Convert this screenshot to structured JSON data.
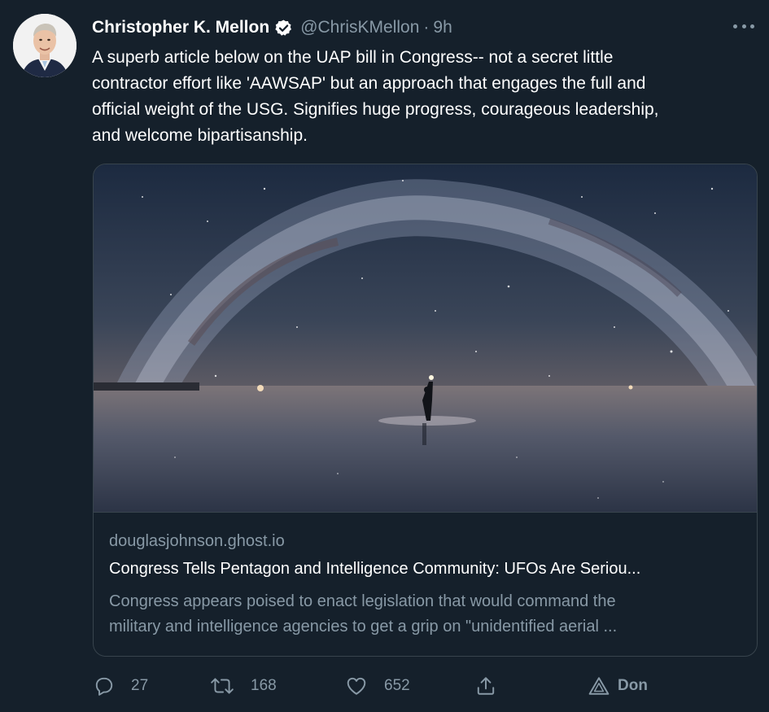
{
  "author": {
    "display_name": "Christopher K. Mellon",
    "handle": "@ChrisKMellon",
    "separator": "·",
    "time": "9h",
    "verified": true,
    "avatar_icon": "avatar-photo"
  },
  "tweet": {
    "text": "A superb article below on the UAP bill in Congress-- not a secret little\ncontractor effort like 'AAWSAP' but an approach that engages the full and\nofficial weight of the USG. Signifies huge progress, courageous leadership,\nand welcome bipartisanship."
  },
  "card": {
    "domain": "douglasjohnson.ghost.io",
    "title": "Congress Tells Pentagon and Intelligence Community: UFOs Are Seriou...",
    "description": "Congress appears poised to enact legislation that would command the\nmilitary and intelligence agencies to get a grip on \"unidentified aerial ...",
    "image_icon": "milky-way-photo"
  },
  "actions": {
    "reply_count": "27",
    "retweet_count": "168",
    "like_count": "652",
    "don_label": "Don"
  },
  "colors": {
    "background": "#15202b",
    "secondary_text": "#8899a6",
    "border": "#38444d",
    "verified_badge": "#ffffff"
  }
}
